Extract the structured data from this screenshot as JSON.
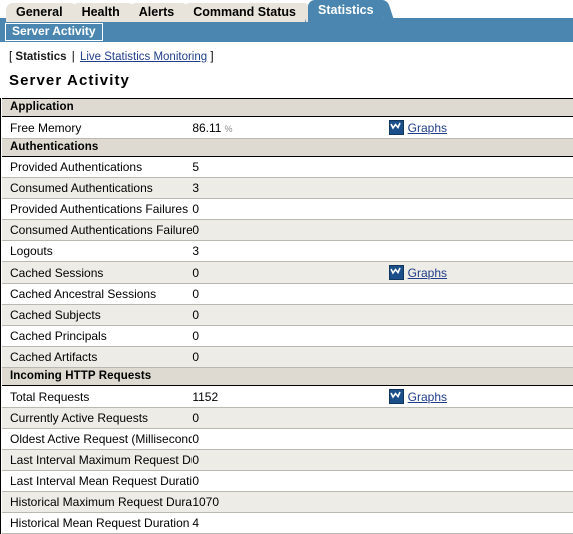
{
  "tabs": [
    {
      "label": "General",
      "active": false
    },
    {
      "label": "Health",
      "active": false
    },
    {
      "label": "Alerts",
      "active": false
    },
    {
      "label": "Command Status",
      "active": false
    },
    {
      "label": "Statistics",
      "active": true
    }
  ],
  "subtab": {
    "label": "Server Activity"
  },
  "breadcrumb": {
    "open_bracket": "[",
    "current": "Statistics",
    "separator": "|",
    "link": "Live Statistics Monitoring",
    "close_bracket": "]"
  },
  "page_title": "Server Activity",
  "graph_link_label": "Graphs",
  "graph_icon_name": "chart-graph-icon",
  "colors": {
    "accent_blue": "#4a86b0",
    "tab_inactive": "#e8e4db",
    "section_header": "#dedad1",
    "row_alt": "#eeece6",
    "link": "#1f3d8a",
    "icon_blue": "#1a4f8a"
  },
  "sections": [
    {
      "title": "Application",
      "rows": [
        {
          "label": "Free Memory",
          "value": "86.11",
          "unit": "%",
          "graphs": true
        }
      ]
    },
    {
      "title": "Authentications",
      "rows": [
        {
          "label": "Provided Authentications",
          "value": "5",
          "unit": "",
          "graphs": false
        },
        {
          "label": "Consumed Authentications",
          "value": "3",
          "unit": "",
          "graphs": false
        },
        {
          "label": "Provided Authentications Failures",
          "value": "0",
          "unit": "",
          "graphs": false
        },
        {
          "label": "Consumed Authentications Failures",
          "value": "0",
          "unit": "",
          "graphs": false
        },
        {
          "label": "Logouts",
          "value": "3",
          "unit": "",
          "graphs": false
        },
        {
          "label": "Cached Sessions",
          "value": "0",
          "unit": "",
          "graphs": true
        },
        {
          "label": "Cached Ancestral Sessions",
          "value": "0",
          "unit": "",
          "graphs": false
        },
        {
          "label": "Cached Subjects",
          "value": "0",
          "unit": "",
          "graphs": false
        },
        {
          "label": "Cached Principals",
          "value": "0",
          "unit": "",
          "graphs": false
        },
        {
          "label": "Cached Artifacts",
          "value": "0",
          "unit": "",
          "graphs": false
        }
      ]
    },
    {
      "title": "Incoming HTTP Requests",
      "rows": [
        {
          "label": "Total Requests",
          "value": "1152",
          "unit": "",
          "graphs": true
        },
        {
          "label": "Currently Active Requests",
          "value": "0",
          "unit": "",
          "graphs": false
        },
        {
          "label": "Oldest Active Request (Milliseconds)",
          "value": "0",
          "unit": "",
          "graphs": false
        },
        {
          "label": "Last Interval Maximum Request Duration (Milliseconds)",
          "value": "0",
          "unit": "",
          "graphs": false
        },
        {
          "label": "Last Interval Mean Request Duration (Milliseconds)",
          "value": "0",
          "unit": "",
          "graphs": false
        },
        {
          "label": "Historical Maximum Request Duration (Milliseconds)",
          "value": "1070",
          "unit": "",
          "graphs": false
        },
        {
          "label": "Historical Mean Request Duration (Milliseconds)",
          "value": "4",
          "unit": "",
          "graphs": false
        }
      ]
    }
  ]
}
